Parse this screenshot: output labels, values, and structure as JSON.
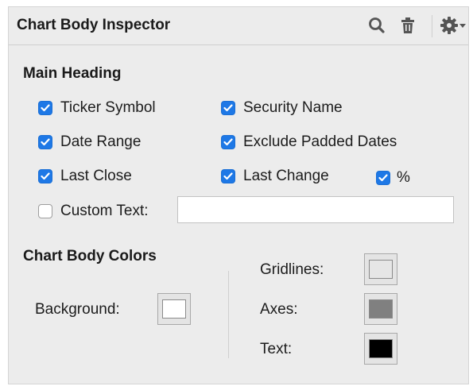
{
  "header": {
    "title": "Chart Body Inspector",
    "icons": [
      "search-icon",
      "trash-icon",
      "gear-icon",
      "chevron-down-icon"
    ]
  },
  "main_heading": {
    "title": "Main Heading",
    "options": {
      "ticker_symbol": {
        "label": "Ticker Symbol",
        "checked": true
      },
      "security_name": {
        "label": "Security Name",
        "checked": true
      },
      "date_range": {
        "label": "Date Range",
        "checked": true
      },
      "exclude_padded_dates": {
        "label": "Exclude Padded Dates",
        "checked": true
      },
      "last_close": {
        "label": "Last Close",
        "checked": true
      },
      "last_change": {
        "label": "Last Change",
        "checked": true
      },
      "percent": {
        "label": "%",
        "checked": true
      },
      "custom_text": {
        "label": "Custom Text:",
        "checked": false,
        "value": "",
        "placeholder": ""
      }
    }
  },
  "chart_body_colors": {
    "title": "Chart Body Colors",
    "background": {
      "label": "Background:",
      "color": "#ffffff"
    },
    "gridlines": {
      "label": "Gridlines:",
      "color": "#e6e6e6"
    },
    "axes": {
      "label": "Axes:",
      "color": "#808080"
    },
    "text": {
      "label": "Text:",
      "color": "#000000"
    }
  },
  "colors": {
    "accent": "#1e78e6",
    "panel_bg": "#ececec"
  }
}
